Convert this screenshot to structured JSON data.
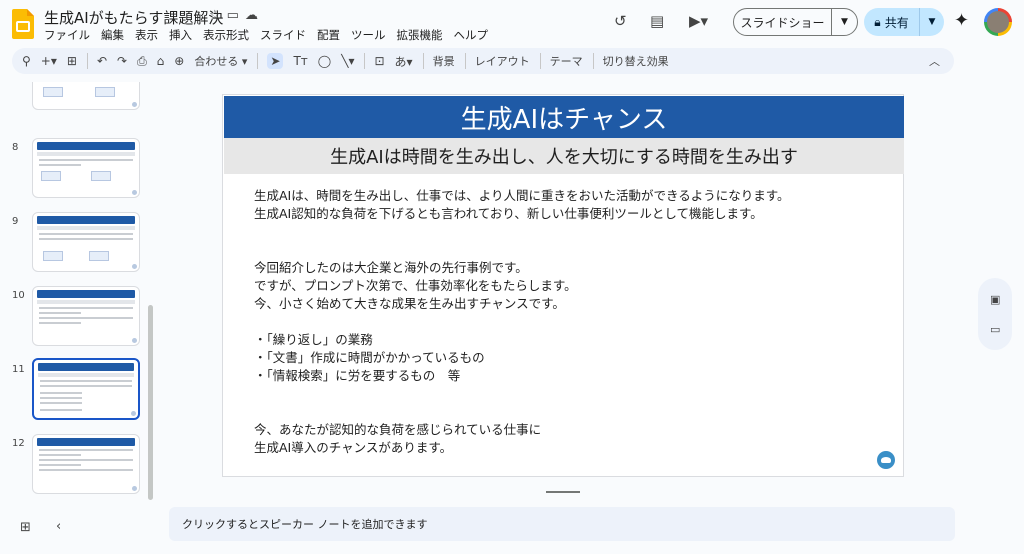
{
  "doc": {
    "title": "生成AIがもたらす課題解決"
  },
  "menu": [
    "ファイル",
    "編集",
    "表示",
    "挿入",
    "表示形式",
    "スライド",
    "配置",
    "ツール",
    "拡張機能",
    "ヘルプ"
  ],
  "header": {
    "slideshow_label": "スライドショー",
    "share_label": "共有"
  },
  "toolbar": {
    "zoom_label": "合わせる",
    "background_label": "背景",
    "layout_label": "レイアウト",
    "theme_label": "テーマ",
    "transition_label": "切り替え効果",
    "text_style_label": "あ"
  },
  "filmstrip": {
    "numbers": [
      "8",
      "9",
      "10",
      "11",
      "12"
    ]
  },
  "slide": {
    "title": "生成AIはチャンス",
    "subtitle": "生成AIは時間を生み出し、人を大切にする時間を生み出す",
    "lines": [
      "生成AIは、時間を生み出し、仕事では、より人間に重きをおいた活動ができるようになります。",
      "生成AI認知的な負荷を下げるとも言われており、新しい仕事便利ツールとして機能します。",
      "今回紹介したのは大企業と海外の先行事例です。",
      "ですが、プロンプト次第で、仕事効率化をもたらします。",
      "今、小さく始めて大きな成果を生み出すチャンスです。",
      "・「繰り返し」の業務",
      "・「文書」作成に時間がかかっているもの",
      "・「情報検索」に労を要するもの　等",
      "今、あなたが認知的な負荷を感じられている仕事に",
      "生成AI導入のチャンスがあります。"
    ]
  },
  "notes": {
    "placeholder": "クリックするとスピーカー ノートを追加できます"
  }
}
